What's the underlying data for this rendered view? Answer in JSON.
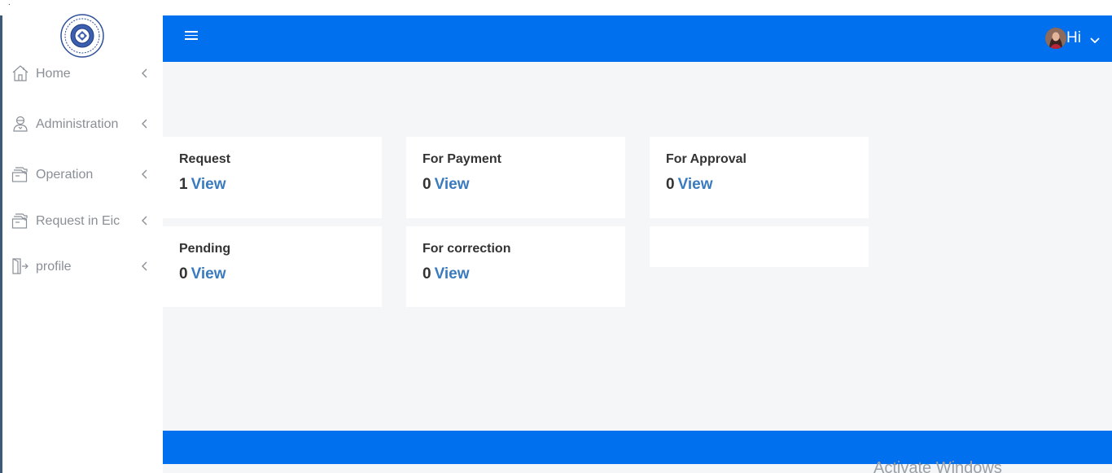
{
  "top_marker": ".",
  "sidebar": {
    "items": [
      {
        "label": "Home",
        "icon": "home-icon"
      },
      {
        "label": "Administration",
        "icon": "admin-user-icon"
      },
      {
        "label": "Operation",
        "icon": "folder-stack-icon"
      },
      {
        "label": "Request in Eic",
        "icon": "folder-stack-icon"
      },
      {
        "label": "profile",
        "icon": "door-exit-icon"
      }
    ]
  },
  "header": {
    "greeting": "Hi",
    "accent_color": "#0070ef"
  },
  "cards": [
    {
      "title": "Request",
      "count": "1",
      "link": "View"
    },
    {
      "title": "For Payment",
      "count": "0",
      "link": "View"
    },
    {
      "title": "For Approval",
      "count": "0",
      "link": "View"
    },
    {
      "title": "Pending",
      "count": "0",
      "link": "View"
    },
    {
      "title": "For correction",
      "count": "0",
      "link": "View"
    }
  ],
  "watermark": "Activate Windows"
}
